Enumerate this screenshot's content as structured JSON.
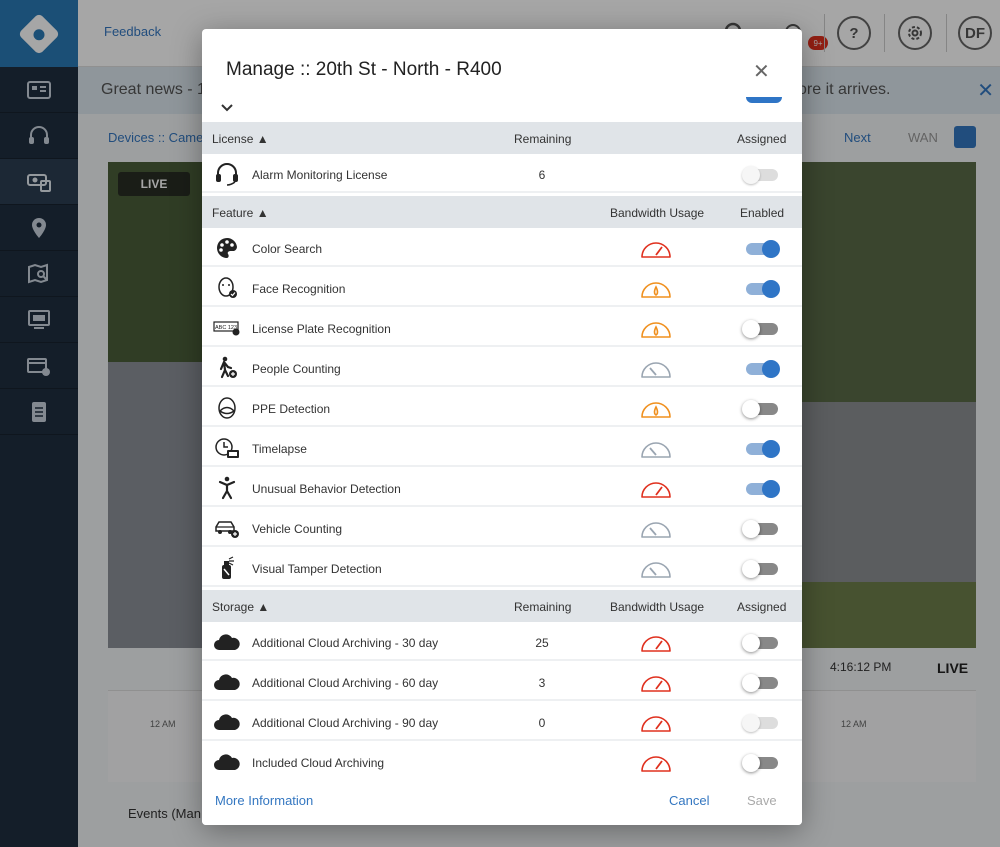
{
  "header": {
    "feedback": "Feedback",
    "notification_badge": "9+",
    "help_label": "?",
    "avatar": "DF"
  },
  "banner": {
    "text_left": "Great news - 1",
    "text_right": "ore it arrives.",
    "close": "✕"
  },
  "breadcrumb": {
    "text": "Devices :: Camer",
    "next": "Next",
    "wan": "WAN"
  },
  "camera": {
    "live_label": "LIVE",
    "time": "4:16:12 PM",
    "live_text": "LIVE",
    "timeline_label_left": "12 AM",
    "timeline_label_right": "12 AM"
  },
  "events": {
    "label": "Events (Man"
  },
  "modal": {
    "title": "Manage :: 20th St - North - R400",
    "close": "✕",
    "license_section": {
      "header": "License ▲",
      "col_remaining": "Remaining",
      "col_assigned": "Assigned",
      "rows": [
        {
          "name": "Alarm Monitoring License",
          "remaining": "6",
          "toggle": "disabled",
          "icon": "headset-icon"
        }
      ]
    },
    "feature_section": {
      "header": "Feature ▲",
      "col_bandwidth": "Bandwidth Usage",
      "col_enabled": "Enabled",
      "rows": [
        {
          "name": "Color Search",
          "bandwidth": "high",
          "toggle": "on",
          "icon": "palette-icon"
        },
        {
          "name": "Face Recognition",
          "bandwidth": "medium",
          "toggle": "on",
          "icon": "face-icon"
        },
        {
          "name": "License Plate Recognition",
          "bandwidth": "medium",
          "toggle": "off",
          "icon": "license-plate-icon",
          "icon_text": "ABC 123"
        },
        {
          "name": "People Counting",
          "bandwidth": "low",
          "toggle": "on",
          "icon": "walking-person-icon"
        },
        {
          "name": "PPE Detection",
          "bandwidth": "medium",
          "toggle": "off",
          "icon": "ppe-icon"
        },
        {
          "name": "Timelapse",
          "bandwidth": "low",
          "toggle": "on",
          "icon": "timelapse-icon"
        },
        {
          "name": "Unusual Behavior Detection",
          "bandwidth": "high",
          "toggle": "on",
          "icon": "behavior-person-icon"
        },
        {
          "name": "Vehicle Counting",
          "bandwidth": "low",
          "toggle": "off",
          "icon": "vehicle-icon"
        },
        {
          "name": "Visual Tamper Detection",
          "bandwidth": "low",
          "toggle": "off",
          "icon": "spray-can-icon"
        }
      ]
    },
    "storage_section": {
      "header": "Storage ▲",
      "col_remaining": "Remaining",
      "col_bandwidth": "Bandwidth Usage",
      "col_assigned": "Assigned",
      "rows": [
        {
          "name": "Additional Cloud Archiving - 30 day",
          "remaining": "25",
          "bandwidth": "high",
          "toggle": "off",
          "icon": "cloud-icon"
        },
        {
          "name": "Additional Cloud Archiving - 60 day",
          "remaining": "3",
          "bandwidth": "high",
          "toggle": "off",
          "icon": "cloud-icon"
        },
        {
          "name": "Additional Cloud Archiving - 90 day",
          "remaining": "0",
          "bandwidth": "high",
          "toggle": "disabled",
          "icon": "cloud-icon"
        },
        {
          "name": "Included Cloud Archiving",
          "remaining": "",
          "bandwidth": "high",
          "toggle": "off",
          "icon": "cloud-icon"
        }
      ]
    },
    "footer": {
      "more_info": "More Information",
      "cancel": "Cancel",
      "save": "Save"
    }
  },
  "colors": {
    "accent": "#2f75c6",
    "link": "#3477c1",
    "bandwidth_high": "#e0301e",
    "bandwidth_medium": "#f0901e",
    "bandwidth_low": "#9aa5b1"
  }
}
